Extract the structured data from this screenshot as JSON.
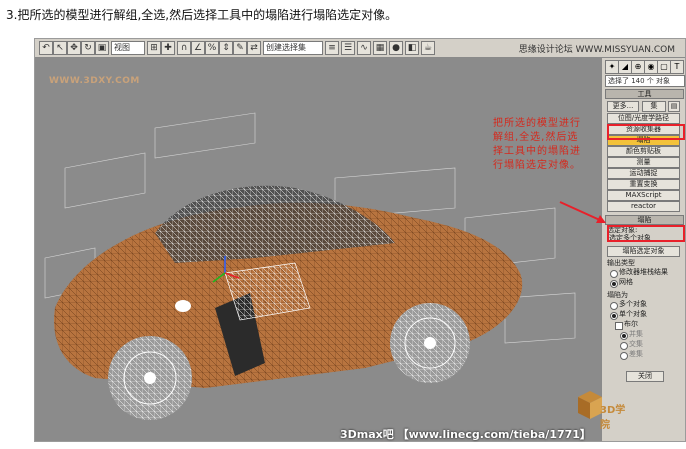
{
  "caption": "3.把所选的模型进行解组,全选,然后选择工具中的塌陷进行塌陷选定对像。",
  "toolbar": {
    "view_select": "视图",
    "selection_set_select": "创建选择集",
    "right_label": "思缘设计论坛 WWW.MISSYUAN.COM"
  },
  "watermark_top_left": "WWW.3DXY.COM",
  "panel": {
    "selection_count": "选择了 140 个 对象",
    "tools_rollout": "工具",
    "more_button": "更多...",
    "set_button": "集",
    "utility_buttons": [
      "位图/光度学路径",
      "资源收集器",
      "塌陷",
      "颜色剪贴板",
      "测量",
      "运动捕捉",
      "重置变换",
      "MAXScript",
      "reactor"
    ],
    "collapse_rollout": "塌陷",
    "selected_label": "选定对象:",
    "selected_value": "选定多个对象",
    "collapse_selected_button": "塌陷选定对象",
    "output_type_label": "输出类型",
    "output_options": [
      "修改器堆栈结果",
      "网格"
    ],
    "collapse_to_label": "塌陷为",
    "collapse_to_options": [
      "多个对象",
      "单个对象"
    ],
    "boolean_label": "布尔",
    "boolean_options": [
      "并集",
      "交集",
      "差集"
    ],
    "close_button": "关闭"
  },
  "annotation": "把所选的模型进行解组,全选,然后选择工具中的塌陷进行塌陷选定对像。",
  "bottom_watermark": "3Dmax吧 【www.linecg.com/tieba/1771】",
  "logo_text": "3D学院",
  "colors": {
    "highlight": "#e8202a",
    "annotation": "#d42a1e",
    "car_body": "#b8743f"
  }
}
